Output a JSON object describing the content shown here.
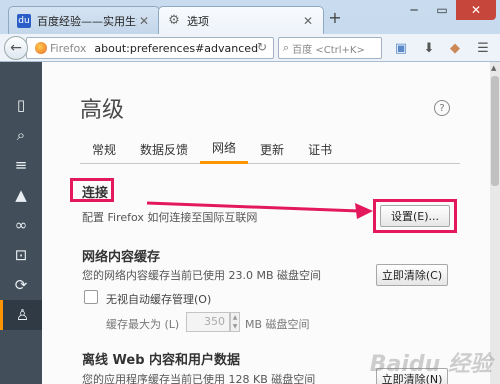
{
  "tabs": [
    {
      "label": "百度经验——实用生活指南",
      "icon": "baidu-icon"
    },
    {
      "label": "选项",
      "icon": "gear-icon"
    }
  ],
  "navbar": {
    "identity_label": "Firefox",
    "url": "about:preferences#advanced",
    "search_placeholder": "百度 <Ctrl+K>"
  },
  "page": {
    "title": "高级",
    "help": "?",
    "tabs": [
      "常规",
      "数据反馈",
      "网络",
      "更新",
      "证书"
    ],
    "selected_tab": "网络"
  },
  "connection": {
    "heading": "连接",
    "description": "配置 Firefox 如何连接至国际互联网",
    "settings_button": "设置(E)..."
  },
  "cache": {
    "heading": "网络内容缓存",
    "usage": "您的网络内容缓存当前已使用 23.0 MB 磁盘空间",
    "clear_button": "立即清除(C)",
    "override_label": "无视自动缓存管理(O)",
    "limit_label": "缓存最大为 (L)",
    "limit_value": "350",
    "limit_unit": "MB 磁盘空间"
  },
  "offline": {
    "heading": "离线 Web 内容和用户数据",
    "usage": "您的应用程序缓存当前已使用 128 KB 磁盘空间",
    "clear_button": "立即清除(N)"
  },
  "watermark": "Baidu 经验",
  "colors": {
    "highlight": "#e4185c",
    "accent": "#ff9500",
    "sidebar": "#424f5a"
  }
}
